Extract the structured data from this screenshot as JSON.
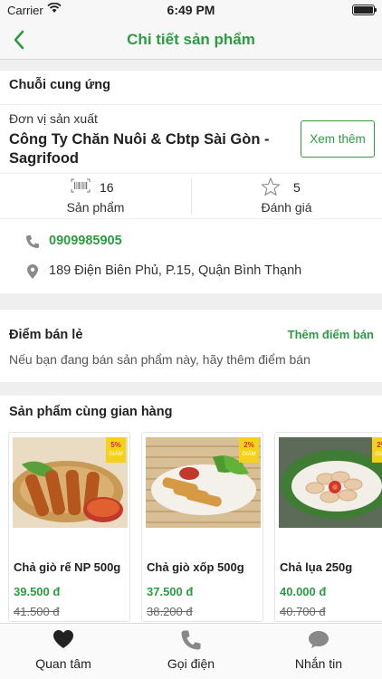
{
  "status_bar": {
    "carrier": "Carrier",
    "time": "6:49 PM"
  },
  "nav": {
    "title": "Chi tiết sản phẩm"
  },
  "supply_chain": {
    "header": "Chuỗi cung ứng",
    "producer_label": "Đơn vị sản xuất",
    "producer_name": "Công Ty Chăn Nuôi & Cbtp Sài Gòn - Sagrifood",
    "more_button": "Xem thêm",
    "product_count": "16",
    "product_label": "Sản phẩm",
    "rating_count": "5",
    "rating_label": "Đánh giá",
    "phone": "0909985905",
    "address": "189 Điện Biên Phủ, P.15, Quận Bình Thạnh"
  },
  "retail": {
    "header": "Điểm bán lẻ",
    "add_link": "Thêm điểm bán",
    "hint": "Nếu bạn đang bán sản phẩm này, hãy thêm điểm bán"
  },
  "same_store": {
    "header": "Sản phẩm cùng gian hàng",
    "products": [
      {
        "name": "Chả giò rế NP 500g",
        "price": "39.500 đ",
        "old_price": "41.500 đ",
        "discount": "5%",
        "discount_label": "GIẢM"
      },
      {
        "name": "Chả giò xốp 500g",
        "price": "37.500 đ",
        "old_price": "38.200 đ",
        "discount": "2%",
        "discount_label": "GIẢM"
      },
      {
        "name": "Chả lụa 250g",
        "price": "40.000 đ",
        "old_price": "40.700 đ",
        "discount": "2%",
        "discount_label": "GIẢM"
      }
    ]
  },
  "tab_bar": {
    "items": [
      {
        "label": "Quan tâm",
        "icon": "heart-icon"
      },
      {
        "label": "Gọi điện",
        "icon": "phone-icon"
      },
      {
        "label": "Nhắn tin",
        "icon": "chat-bubble-icon"
      }
    ]
  },
  "colors": {
    "accent": "#2e9b43",
    "badge": "#f4d216"
  }
}
